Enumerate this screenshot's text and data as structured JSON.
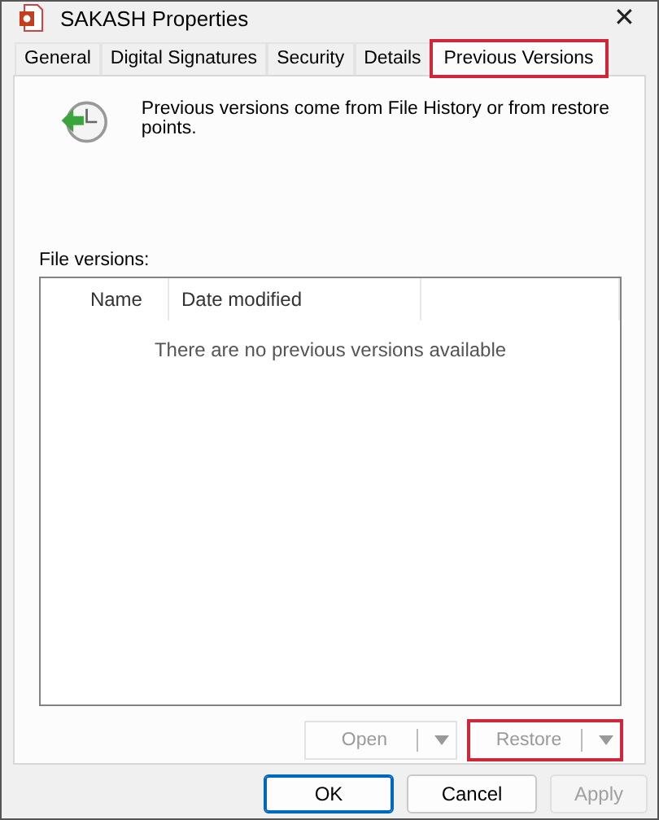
{
  "window": {
    "title": "SAKASH Properties",
    "close": "✕"
  },
  "tabs": [
    {
      "label": "General",
      "selected": false,
      "highlighted": false
    },
    {
      "label": "Digital Signatures",
      "selected": false,
      "highlighted": false
    },
    {
      "label": "Security",
      "selected": false,
      "highlighted": false
    },
    {
      "label": "Details",
      "selected": false,
      "highlighted": false
    },
    {
      "label": "Previous Versions",
      "selected": true,
      "highlighted": true
    }
  ],
  "description": "Previous versions come from File History or from restore points.",
  "file_versions": {
    "label": "File versions:",
    "columns": [
      "Name",
      "Date modified"
    ],
    "empty_message": "There are no previous versions available"
  },
  "split_buttons": [
    {
      "label": "Open",
      "disabled": true,
      "highlighted": false
    },
    {
      "label": "Restore",
      "disabled": true,
      "highlighted": true
    }
  ],
  "buttons": [
    {
      "label": "OK",
      "default": true,
      "disabled": false
    },
    {
      "label": "Cancel",
      "default": false,
      "disabled": false
    },
    {
      "label": "Apply",
      "default": false,
      "disabled": true
    }
  ]
}
